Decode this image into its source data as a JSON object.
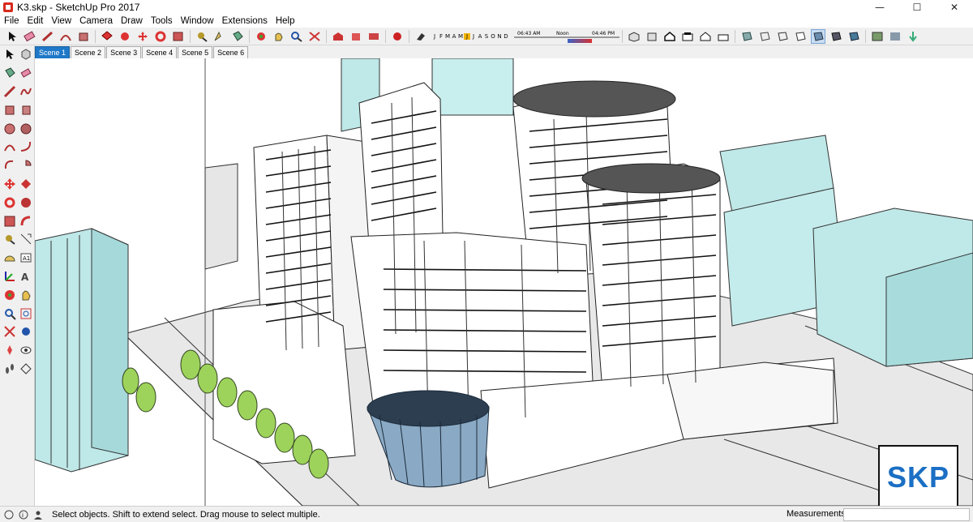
{
  "window": {
    "title": "K3.skp - SketchUp Pro 2017",
    "minimize_glyph": "—",
    "maximize_glyph": "☐",
    "close_glyph": "✕"
  },
  "menu": [
    "File",
    "Edit",
    "View",
    "Camera",
    "Draw",
    "Tools",
    "Window",
    "Extensions",
    "Help"
  ],
  "shadow_settings": {
    "months": [
      "J",
      "F",
      "M",
      "A",
      "M",
      "J",
      "J",
      "A",
      "S",
      "O",
      "N",
      "D"
    ],
    "selected_month_index": 5,
    "time_start": "06:43 AM",
    "time_mid": "Noon",
    "time_end": "04:46 PM"
  },
  "scenes": [
    {
      "label": "Scene 1",
      "active": true
    },
    {
      "label": "Scene 2",
      "active": false
    },
    {
      "label": "Scene 3",
      "active": false
    },
    {
      "label": "Scene 4",
      "active": false
    },
    {
      "label": "Scene 5",
      "active": false
    },
    {
      "label": "Scene 6",
      "active": false
    }
  ],
  "status": {
    "hint": "Select objects. Shift to extend select. Drag mouse to select multiple.",
    "measurements_label": "Measurements",
    "measurements_value": ""
  },
  "watermark": {
    "text": "SKP"
  },
  "colors": {
    "accent_tab": "#1f78c8",
    "building_fill": "#bfe8e8",
    "tree_fill": "#9dd35a",
    "skp_blue": "#1b6fc4"
  },
  "toolbar_icons": [
    "select-icon",
    "eraser-icon",
    "pencil-icon",
    "shapes-icon",
    "paint-icon",
    "push-pull-icon",
    "move-icon",
    "rotate-icon",
    "scale-icon",
    "offset-icon",
    "tape-measure-icon",
    "text-icon",
    "axes-icon",
    "orbit-icon",
    "pan-icon",
    "zoom-icon",
    "zoom-extents-icon",
    "warehouse-icon",
    "extension-icon",
    "layout-icon",
    "shadow-icon",
    "styles-icon",
    "iso-view-icon",
    "top-view-icon",
    "front-view-icon",
    "right-view-icon",
    "back-view-icon",
    "left-view-icon",
    "xray-icon",
    "backedges-icon",
    "wireframe-icon",
    "hiddenline-icon",
    "shaded-icon",
    "textured-icon",
    "monochrome-icon",
    "sandbox-icon",
    "geo-icon"
  ]
}
